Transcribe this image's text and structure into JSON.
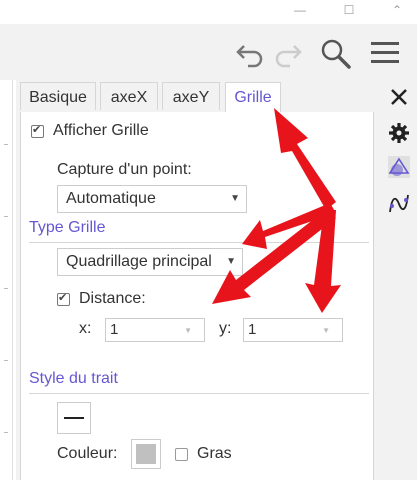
{
  "tabs": [
    {
      "label": "Basique"
    },
    {
      "label": "axeX"
    },
    {
      "label": "axeY"
    },
    {
      "label": "Grille"
    }
  ],
  "grid": {
    "show_grid_label": "Afficher Grille",
    "show_grid_checked": true,
    "point_capture_label": "Capture d'un point:",
    "point_capture_value": "Automatique",
    "grid_type_section": "Type Grille",
    "grid_type_value": "Quadrillage principal",
    "distance_label": "Distance:",
    "distance_checked": true,
    "x_label": "x:",
    "x_value": "1",
    "y_label": "y:",
    "y_value": "1"
  },
  "line_style": {
    "section": "Style du trait",
    "color_label": "Couleur:",
    "color_value": "#c0c0c0",
    "bold_label": "Gras",
    "bold_checked": false
  },
  "colors": {
    "accent": "#6557d2",
    "annotation_arrow": "#e8141c",
    "panel_bg": "#f2f2f2"
  },
  "icons": {
    "undo": "undo-icon",
    "redo": "redo-icon",
    "search": "search-icon",
    "menu": "menu-icon",
    "close": "close-icon",
    "settings": "gear-icon",
    "geometry": "triangle-circle-icon",
    "graphics": "curve-icon"
  }
}
